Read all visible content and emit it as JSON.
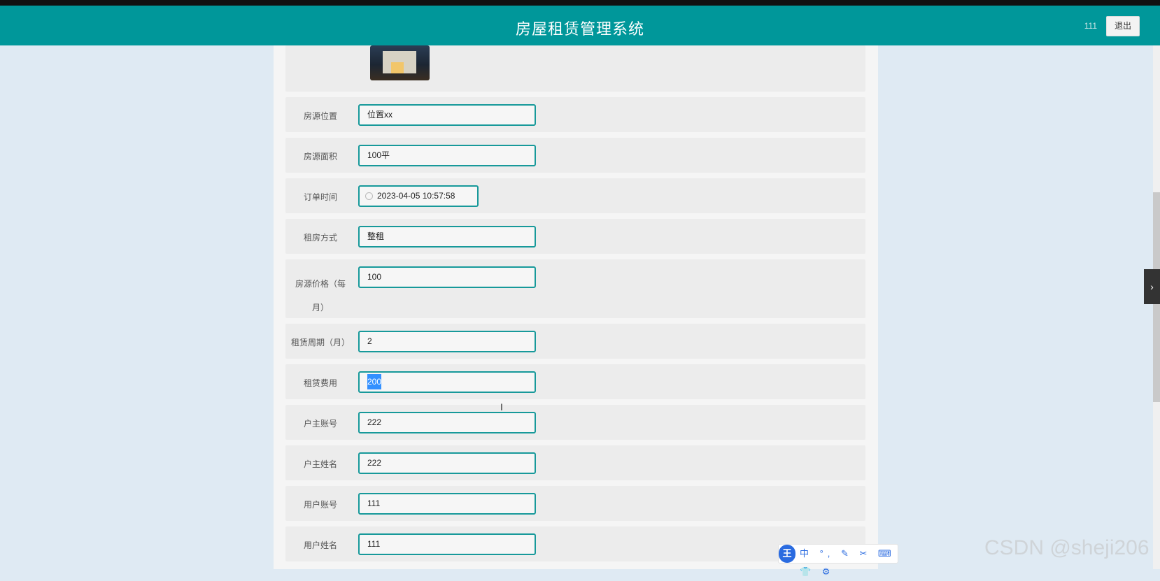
{
  "header": {
    "title": "房屋租赁管理系统",
    "user": "111",
    "logout": "退出"
  },
  "form": {
    "fields": [
      {
        "label": "房源位置",
        "value": "位置xx"
      },
      {
        "label": "房源面积",
        "value": "100平"
      },
      {
        "label": "订单时间",
        "value": "2023-04-05 10:57:58"
      },
      {
        "label": "租房方式",
        "value": "整租"
      },
      {
        "label": "房源价格（每月）",
        "value": "100"
      },
      {
        "label": "租赁周期（月）",
        "value": "2"
      },
      {
        "label": "租赁费用",
        "value": "200"
      },
      {
        "label": "户主账号",
        "value": "222"
      },
      {
        "label": "户主姓名",
        "value": "222"
      },
      {
        "label": "用户账号",
        "value": "111"
      },
      {
        "label": "用户姓名",
        "value": "111"
      }
    ]
  },
  "ime": {
    "logo": "王",
    "items": "中 °, ✎ ✂ ⌨ 👕 ⚙"
  },
  "watermark": "CSDN @sheji206"
}
